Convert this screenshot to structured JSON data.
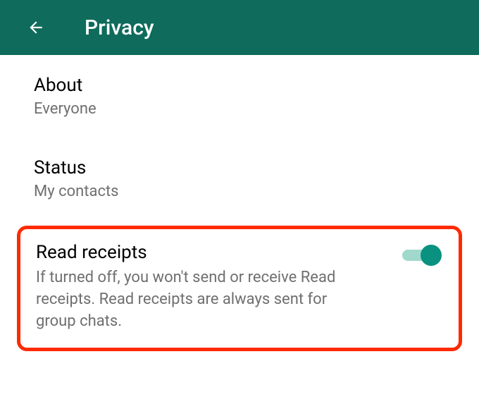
{
  "header": {
    "title": "Privacy"
  },
  "settings": {
    "about": {
      "label": "About",
      "value": "Everyone"
    },
    "status": {
      "label": "Status",
      "value": "My contacts"
    },
    "readReceipts": {
      "label": "Read receipts",
      "description": "If turned off, you won't send or receive Read receipts. Read receipts are always sent for group chats.",
      "enabled": true
    }
  },
  "colors": {
    "headerBg": "#0f6b5c",
    "toggleOn": "#0a9180",
    "highlight": "#ff2a00"
  }
}
